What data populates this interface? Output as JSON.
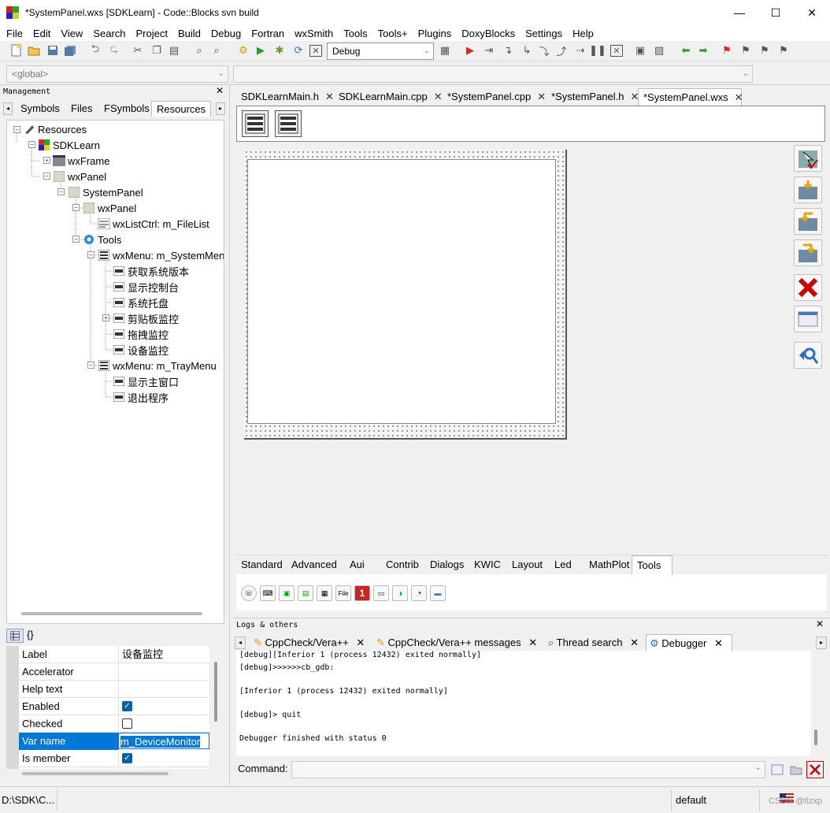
{
  "window": {
    "title": "*SystemPanel.wxs [SDKLearn] - Code::Blocks svn build",
    "minimize": "—",
    "maximize": "☐",
    "close": "✕"
  },
  "menu": [
    "File",
    "Edit",
    "View",
    "Search",
    "Project",
    "Build",
    "Debug",
    "Fortran",
    "wxSmith",
    "Tools",
    "Tools+",
    "Plugins",
    "DoxyBlocks",
    "Settings",
    "Help"
  ],
  "toolbar": {
    "build_target": "Debug"
  },
  "code_toolbar": {
    "scope": "<global>"
  },
  "management": {
    "title": "Management",
    "close": "✕",
    "tabs": [
      "Symbols",
      "Files",
      "FSymbols",
      "Resources"
    ],
    "active_tab": "Resources",
    "tree": [
      {
        "label": "Resources",
        "depth": 0
      },
      {
        "label": "SDKLearn",
        "depth": 1
      },
      {
        "label": "wxFrame",
        "depth": 2
      },
      {
        "label": "wxPanel",
        "depth": 2
      },
      {
        "label": "SystemPanel",
        "depth": 3
      },
      {
        "label": "wxPanel",
        "depth": 4
      },
      {
        "label": "wxListCtrl: m_FileList",
        "depth": 5
      },
      {
        "label": "Tools",
        "depth": 4
      },
      {
        "label": "wxMenu: m_SystemMenu",
        "depth": 5
      },
      {
        "label": "获取系统版本",
        "depth": 6
      },
      {
        "label": "显示控制台",
        "depth": 6
      },
      {
        "label": "系统托盘",
        "depth": 6
      },
      {
        "label": "剪贴板监控",
        "depth": 6
      },
      {
        "label": "拖拽监控",
        "depth": 6
      },
      {
        "label": "设备监控",
        "depth": 6
      },
      {
        "label": "wxMenu: m_TrayMenu",
        "depth": 5
      },
      {
        "label": "显示主窗口",
        "depth": 6
      },
      {
        "label": "退出程序",
        "depth": 6
      }
    ]
  },
  "properties": {
    "mode_btn2": "{}",
    "rows": [
      {
        "name": "Label",
        "value": "设备监控",
        "type": "text"
      },
      {
        "name": "Accelerator",
        "value": "",
        "type": "text"
      },
      {
        "name": "Help text",
        "value": "",
        "type": "text"
      },
      {
        "name": "Enabled",
        "value": "true",
        "type": "check"
      },
      {
        "name": "Checked",
        "value": "false",
        "type": "check"
      },
      {
        "name": "Var name",
        "value": "m_DeviceMonitor",
        "type": "edit"
      },
      {
        "name": "Is member",
        "value": "true",
        "type": "check"
      }
    ]
  },
  "editor": {
    "tabs": [
      {
        "label": "SDKLearnMain.h"
      },
      {
        "label": "SDKLearnMain.cpp"
      },
      {
        "label": "*SystemPanel.cpp"
      },
      {
        "label": "*SystemPanel.h"
      },
      {
        "label": "*SystemPanel.wxs"
      }
    ],
    "active_tab": "*SystemPanel.wxs",
    "tab_close": "✕"
  },
  "palette": {
    "tabs": [
      "Standard",
      "Advanced",
      "Aui",
      "Contrib",
      "Dialogs",
      "KWIC",
      "Layout",
      "Led",
      "MathPlot",
      "Tools"
    ],
    "active_tab": "Tools",
    "icons": [
      "☏",
      "⌨",
      "▣",
      "▤",
      "▦",
      "File",
      "1",
      "▭",
      "◑",
      "◔",
      "▬"
    ]
  },
  "logs": {
    "title": "Logs & others",
    "close": "✕",
    "tabs": [
      {
        "label": "CppCheck/Vera++"
      },
      {
        "label": "CppCheck/Vera++ messages"
      },
      {
        "label": "Thread search"
      },
      {
        "label": "Debugger"
      }
    ],
    "active_tab": "Debugger",
    "tab_close": "✕",
    "lines": [
      "[debug][Inferior 1 (process 12432) exited normally]",
      "[debug]>>>>>>cb_gdb:",
      "",
      "[Inferior 1 (process 12432) exited normally]",
      "",
      "[debug]> quit",
      "",
      "Debugger finished with status 0"
    ],
    "command_label": "Command:"
  },
  "status": {
    "path": "D:\\SDK\\C...",
    "profile": "default",
    "watermark": "CSDN @tlzxp"
  }
}
